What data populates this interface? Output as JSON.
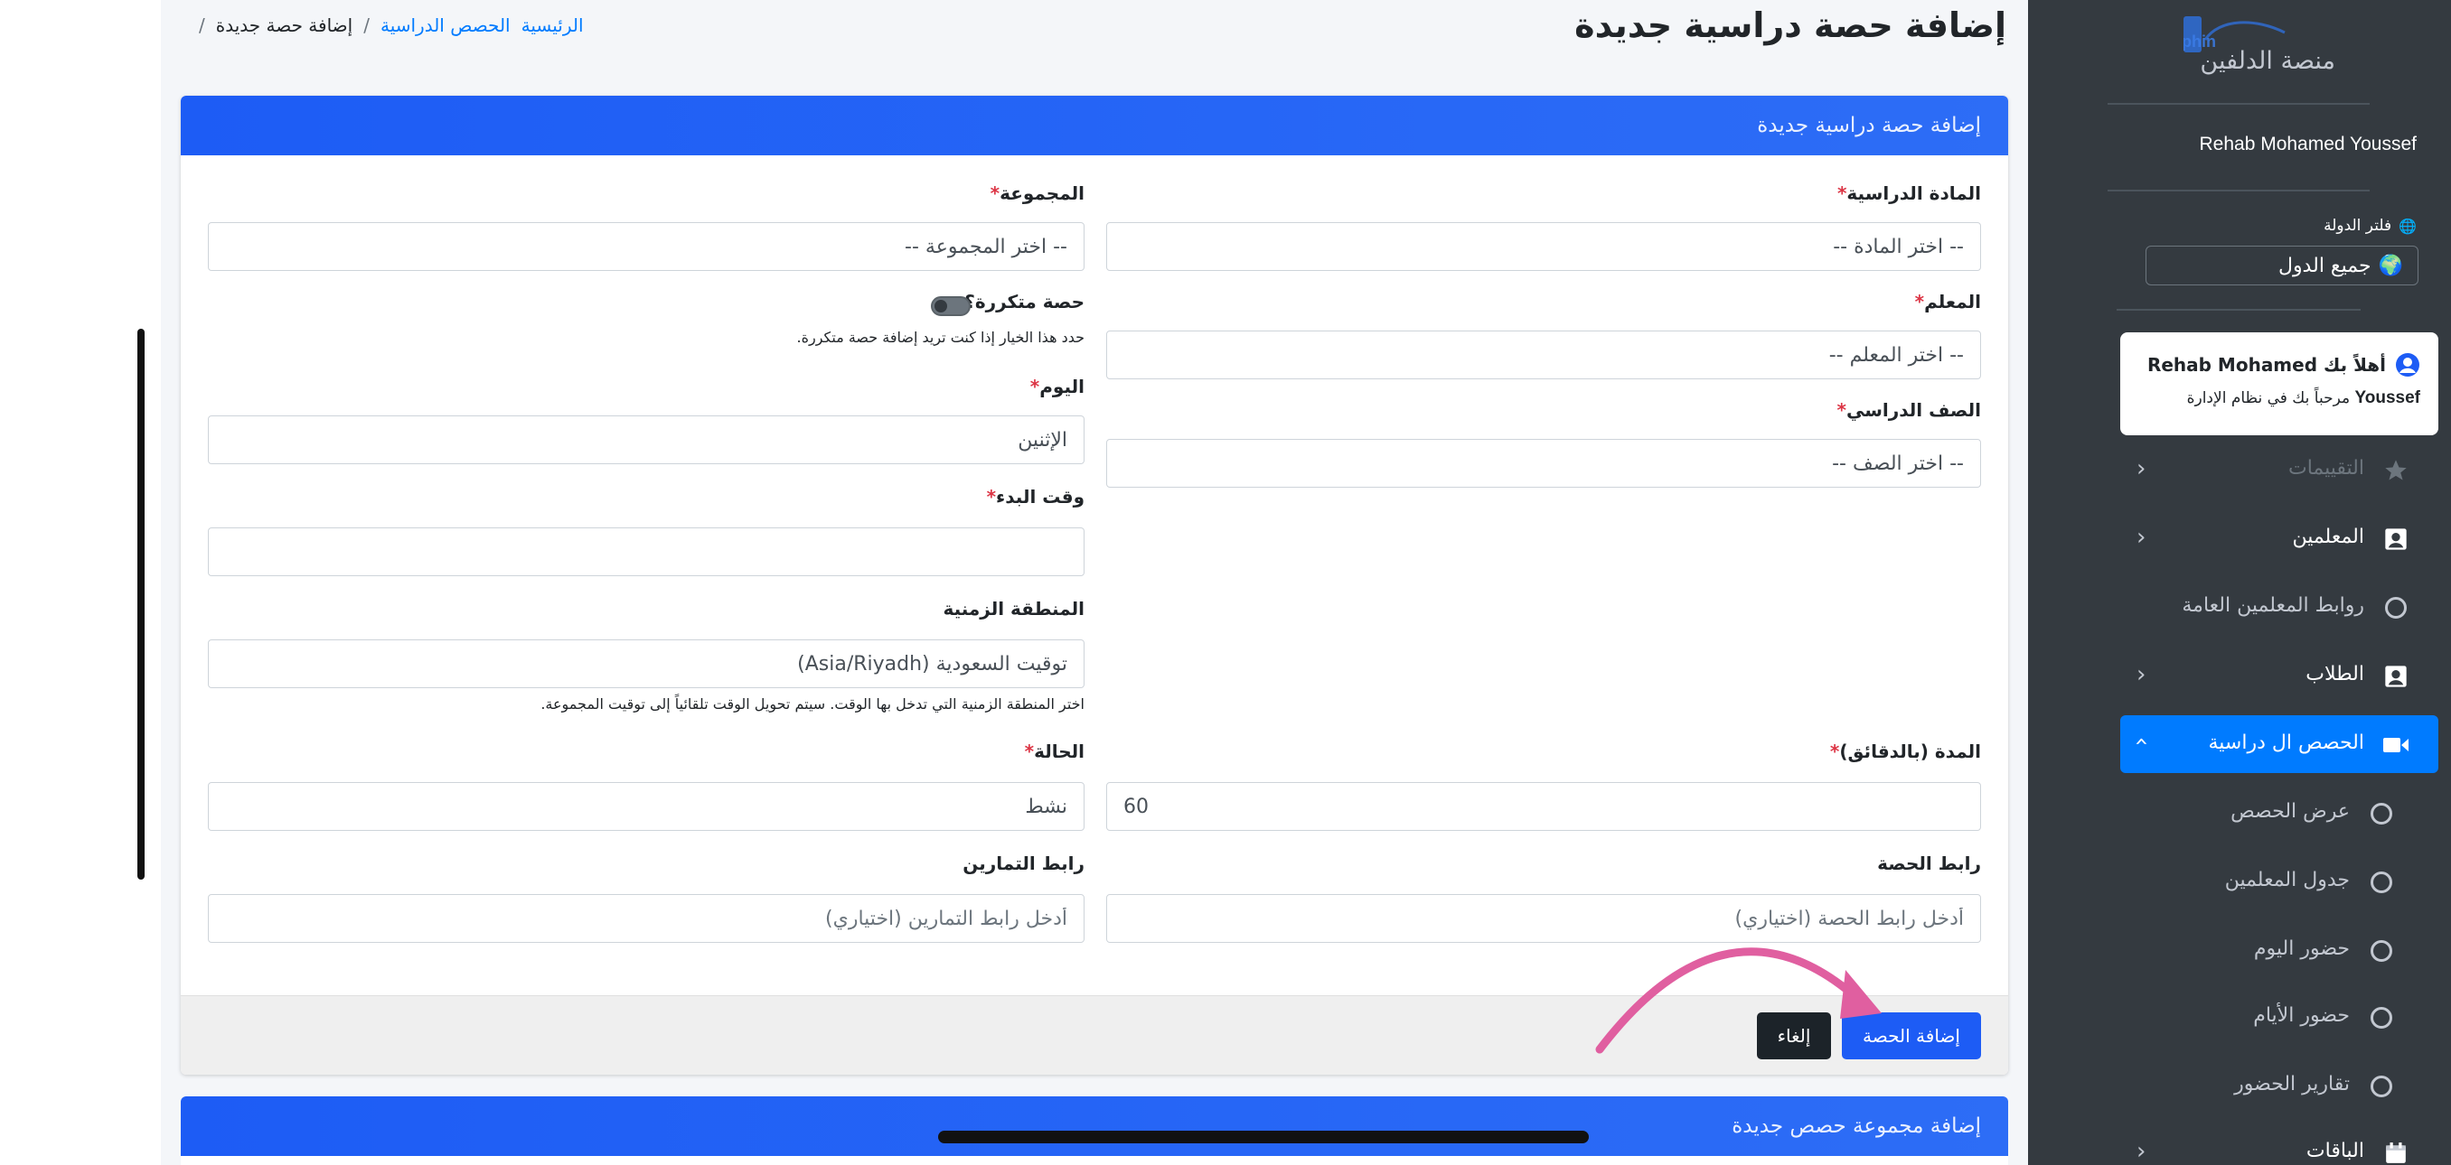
{
  "sidebar": {
    "brand_title": "منصة الدلفين",
    "brand_logo_text": "Dolphin",
    "user_name": "Rehab Mohamed Youssef",
    "country_filter_label": "فلتر الدولة",
    "country_filter_value": "جميع الدول",
    "welcome_greeting": "أهلاً بك Rehab Mohamed",
    "welcome_name_end": "Youssef",
    "welcome_subtitle": "مرحباً بك في نظام الإدارة",
    "items": [
      {
        "label": "التقييمات",
        "icon": "star-icon"
      },
      {
        "label": "المعلمين",
        "icon": "teacher-icon"
      },
      {
        "label": "روابط المعلمين العامة",
        "icon": "circle-icon"
      },
      {
        "label": "الطلاب",
        "icon": "student-icon"
      },
      {
        "label": "الحصص ال دراسية",
        "icon": "video-icon"
      },
      {
        "label": "عرض الحصص",
        "icon": "circle-icon"
      },
      {
        "label": "جدول المعلمين",
        "icon": "circle-icon"
      },
      {
        "label": "حضور اليوم",
        "icon": "circle-icon"
      },
      {
        "label": "حضور الأيام",
        "icon": "circle-icon"
      },
      {
        "label": "تقارير الحضور",
        "icon": "circle-icon"
      },
      {
        "label": "الباقات",
        "icon": "calendar-icon"
      }
    ]
  },
  "header": {
    "page_title": "إضافة حصة دراسية جديدة",
    "breadcrumb": [
      "الرئيسية",
      "الحصص الدراسية",
      "إضافة حصة جديدة"
    ],
    "breadcrumb_sep": "/"
  },
  "form": {
    "card_title": "إضافة حصة دراسية جديدة",
    "subject_label": "المادة الدراسية",
    "subject_value": "-- اختر المادة --",
    "group_label": "المجموعة",
    "group_value": "-- اختر المجموعة --",
    "teacher_label": "المعلم",
    "teacher_value": "-- اختر المعلم --",
    "recurring_label": "حصة متكررة؟",
    "recurring_help": "حدد هذا الخيار إذا كنت تريد إضافة حصة متكررة.",
    "grade_label": "الصف الدراسي",
    "grade_value": "-- اختر الصف --",
    "day_label": "اليوم",
    "day_value": "الإثنين",
    "start_time_label": "وقت البدء",
    "start_time_value": "",
    "timezone_label": "المنطقة الزمنية",
    "timezone_value": "توقيت السعودية (Asia/Riyadh)",
    "timezone_help": "اختر المنطقة الزمنية التي تدخل بها الوقت. سيتم تحويل الوقت تلقائياً إلى توقيت المجموعة.",
    "duration_label": "المدة (بالدقائق)",
    "duration_value": "60",
    "status_label": "الحالة",
    "status_value": "نشط",
    "lesson_link_label": "رابط الحصة",
    "lesson_link_placeholder": "أدخل رابط الحصة (اختياري)",
    "exercises_link_label": "رابط التمارين",
    "exercises_link_placeholder": "أدخل رابط التمارين (اختياري)",
    "submit_label": "إضافة الحصة",
    "cancel_label": "إلغاء",
    "required_mark": "*"
  },
  "second_card": {
    "title": "إضافة مجموعة حصص جديدة"
  },
  "colors": {
    "sidebar_bg": "#343a40",
    "primary": "#1d5cf5",
    "active_nav": "#007bff",
    "required": "#dc3545",
    "annotation_arrow": "#e05fa0"
  }
}
